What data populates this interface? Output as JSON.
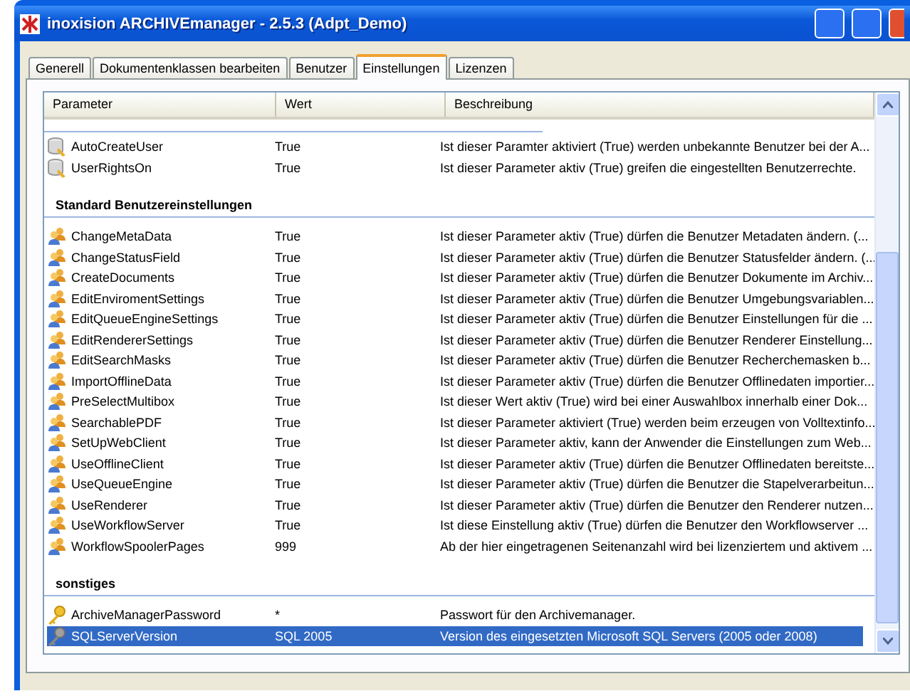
{
  "window": {
    "title": "inoxision ARCHIVEmanager - 2.5.3 (Adpt_Demo)"
  },
  "tabs": [
    {
      "label": "Generell",
      "selected": false
    },
    {
      "label": "Dokumentenklassen bearbeiten",
      "selected": false
    },
    {
      "label": "Benutzer",
      "selected": false
    },
    {
      "label": "Einstellungen",
      "selected": true
    },
    {
      "label": "Lizenzen",
      "selected": false
    }
  ],
  "table": {
    "columns": [
      "Parameter",
      "Wert",
      "Beschreibung"
    ],
    "groups": [
      {
        "rows": [
          {
            "kind": "database",
            "parameter": "AutoCreateUser",
            "value": "True",
            "description": "Ist dieser Paramter aktiviert (True) werden unbekannte Benutzer bei der A...",
            "selected": false
          },
          {
            "kind": "database",
            "parameter": "UserRightsOn",
            "value": "True",
            "description": "Ist dieser Parameter aktiv (True) greifen die eingestellten Benutzerrechte.",
            "selected": false
          }
        ]
      },
      {
        "title": "Standard Benutzereinstellungen",
        "rows": [
          {
            "kind": "users",
            "parameter": "ChangeMetaData",
            "value": "True",
            "description": "Ist dieser Parameter aktiv (True) dürfen die Benutzer Metadaten ändern. (...",
            "selected": false
          },
          {
            "kind": "users",
            "parameter": "ChangeStatusField",
            "value": "True",
            "description": "Ist dieser Parameter aktiv (True) dürfen die Benutzer Statusfelder ändern. (...",
            "selected": false
          },
          {
            "kind": "users",
            "parameter": "CreateDocuments",
            "value": "True",
            "description": "Ist dieser Parameter aktiv (True) dürfen die Benutzer Dokumente im Archiv...",
            "selected": false
          },
          {
            "kind": "users",
            "parameter": "EditEnviromentSettings",
            "value": "True",
            "description": "Ist dieser Parameter aktiv (True) dürfen die Benutzer Umgebungsvariablen...",
            "selected": false
          },
          {
            "kind": "users",
            "parameter": "EditQueueEngineSettings",
            "value": "True",
            "description": "Ist dieser Parameter aktiv (True) dürfen die Benutzer Einstellungen für die ...",
            "selected": false
          },
          {
            "kind": "users",
            "parameter": "EditRendererSettings",
            "value": "True",
            "description": "Ist dieser Parameter aktiv (True) dürfen die Benutzer Renderer Einstellung...",
            "selected": false
          },
          {
            "kind": "users",
            "parameter": "EditSearchMasks",
            "value": "True",
            "description": "Ist dieser Parameter aktiv (True) dürfen die Benutzer Recherchemasken b...",
            "selected": false
          },
          {
            "kind": "users",
            "parameter": "ImportOfflineData",
            "value": "True",
            "description": "Ist dieser Parameter aktiv (True) dürfen die Benutzer Offlinedaten importier...",
            "selected": false
          },
          {
            "kind": "users",
            "parameter": "PreSelectMultibox",
            "value": "True",
            "description": "Ist dieser Wert aktiv (True) wird bei einer Auswahlbox innerhalb einer Dok...",
            "selected": false
          },
          {
            "kind": "users",
            "parameter": "SearchablePDF",
            "value": "True",
            "description": "Ist dieser Parameter aktiviert (True) werden beim erzeugen von Volltextinfo...",
            "selected": false
          },
          {
            "kind": "users",
            "parameter": "SetUpWebClient",
            "value": "True",
            "description": "Ist dieser Parameter aktiv, kann der Anwender die Einstellungen zum Web...",
            "selected": false
          },
          {
            "kind": "users",
            "parameter": "UseOfflineClient",
            "value": "True",
            "description": "Ist dieser Parameter aktiv (True) dürfen die Benutzer Offlinedaten bereitste...",
            "selected": false
          },
          {
            "kind": "users",
            "parameter": "UseQueueEngine",
            "value": "True",
            "description": "Ist dieser Parameter aktiv (True) dürfen die Benutzer die Stapelverarbeitun...",
            "selected": false
          },
          {
            "kind": "users",
            "parameter": "UseRenderer",
            "value": "True",
            "description": "Ist dieser Parameter aktiv (True) dürfen die Benutzer den Renderer nutzen...",
            "selected": false
          },
          {
            "kind": "users",
            "parameter": "UseWorkflowServer",
            "value": "True",
            "description": "Ist diese Einstellung aktiv (True) dürfen die Benutzer den Workflowserver ...",
            "selected": false
          },
          {
            "kind": "users",
            "parameter": "WorkflowSpoolerPages",
            "value": "999",
            "description": "Ab der hier eingetragenen Seitenanzahl wird bei lizenziertem und aktivem ...",
            "selected": false
          }
        ]
      },
      {
        "title": "sonstiges",
        "rows": [
          {
            "kind": "key",
            "parameter": "ArchiveManagerPassword",
            "value": "*",
            "description": "Passwort für den Archivemanager.",
            "selected": false
          },
          {
            "kind": "wrench",
            "parameter": "SQLServerVersion",
            "value": "SQL 2005",
            "description": "Version des eingesetzten Microsoft SQL Servers (2005 oder 2008)",
            "selected": true
          }
        ]
      }
    ]
  }
}
